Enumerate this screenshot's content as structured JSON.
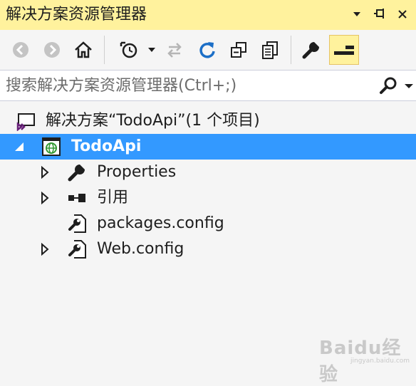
{
  "panel": {
    "title": "解决方案资源管理器"
  },
  "title_controls": [
    "dropdown-arrow-icon",
    "pin-icon",
    "close-icon"
  ],
  "toolbar": {
    "buttons": [
      "back-icon",
      "forward-icon",
      "home-icon",
      "history-icon",
      "sync-icon",
      "refresh-icon",
      "collapse-all-icon",
      "show-all-files-icon",
      "properties-icon",
      "preview-icon"
    ]
  },
  "search": {
    "placeholder": "搜索解决方案资源管理器(Ctrl+;)"
  },
  "tree": {
    "solution_label": "解决方案“TodoApi”(1 个项目)",
    "project_label": "TodoApi",
    "items": [
      {
        "label": "Properties",
        "icon": "wrench-icon",
        "expandable": true
      },
      {
        "label": "引用",
        "icon": "references-icon",
        "expandable": true
      },
      {
        "label": "packages.config",
        "icon": "config-file-icon",
        "expandable": false
      },
      {
        "label": "Web.config",
        "icon": "config-file-icon",
        "expandable": true
      }
    ]
  },
  "watermark": {
    "text": "Baidu经验",
    "sub": "jingyan.baidu.com"
  },
  "colors": {
    "title_bg": "#fff29d",
    "selected_bg": "#3399ff",
    "panel_bg": "#f5f5f5",
    "vs_purple": "#68217a"
  }
}
